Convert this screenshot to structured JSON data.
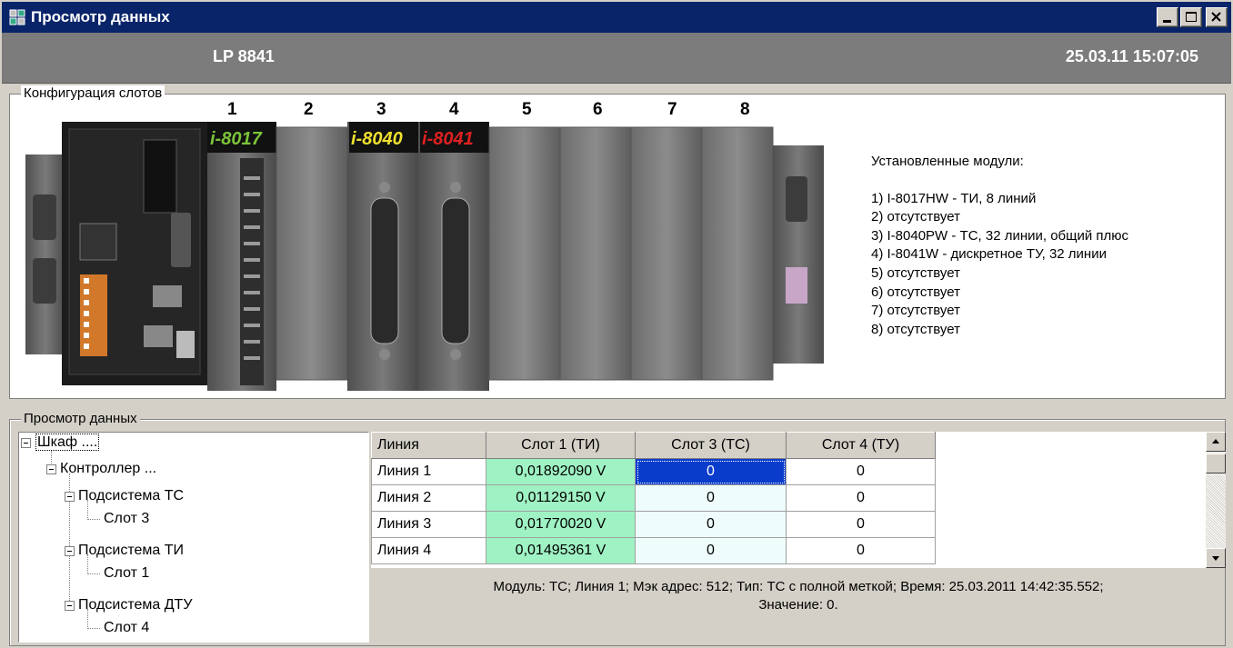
{
  "window": {
    "title": "Просмотр данных"
  },
  "header": {
    "device": "LP 8841",
    "datetime": "25.03.11 15:07:05"
  },
  "slots_group": {
    "legend": "Конфигурация слотов",
    "slot_numbers": [
      "1",
      "2",
      "3",
      "4",
      "5",
      "6",
      "7",
      "8"
    ],
    "module_labels": {
      "slot1": "i-8017",
      "slot3": "i-8040",
      "slot4": "i-8041"
    },
    "installed_heading": "Установленные модули:",
    "installed": [
      "1) I-8017HW - ТИ, 8 линий",
      "2) отсутствует",
      "3) I-8040PW - ТС, 32 линии, общий плюс",
      "4) I-8041W - дискретное ТУ, 32 линии",
      "5) отсутствует",
      "6) отсутствует",
      "7) отсутствует",
      "8) отсутствует"
    ]
  },
  "data_group": {
    "legend": "Просмотр данных",
    "tree": {
      "root": "Шкаф ....",
      "controller": "Контроллер ...",
      "sub_tc": "Подсистема ТС",
      "slot3": "Слот 3",
      "sub_ti": "Подсистема ТИ",
      "slot1": "Слот 1",
      "sub_dtu": "Подсистема ДТУ",
      "slot4": "Слот 4"
    },
    "grid": {
      "columns": [
        "Линия",
        "Слот 1 (ТИ)",
        "Слот 3 (ТС)",
        "Слот 4 (ТУ)"
      ],
      "rows": [
        [
          "Линия 1",
          "0,01892090 V",
          "0",
          "0"
        ],
        [
          "Линия 2",
          "0,01129150 V",
          "0",
          "0"
        ],
        [
          "Линия 3",
          "0,01770020 V",
          "0",
          "0"
        ],
        [
          "Линия 4",
          "0,01495361 V",
          "0",
          "0"
        ]
      ]
    },
    "status_line1": "Модуль: ТС; Линия 1; Мэк адрес: 512; Тип: ТС с полной меткой; Время: 25.03.2011 14:42:35.552;",
    "status_line2": "Значение: 0."
  }
}
